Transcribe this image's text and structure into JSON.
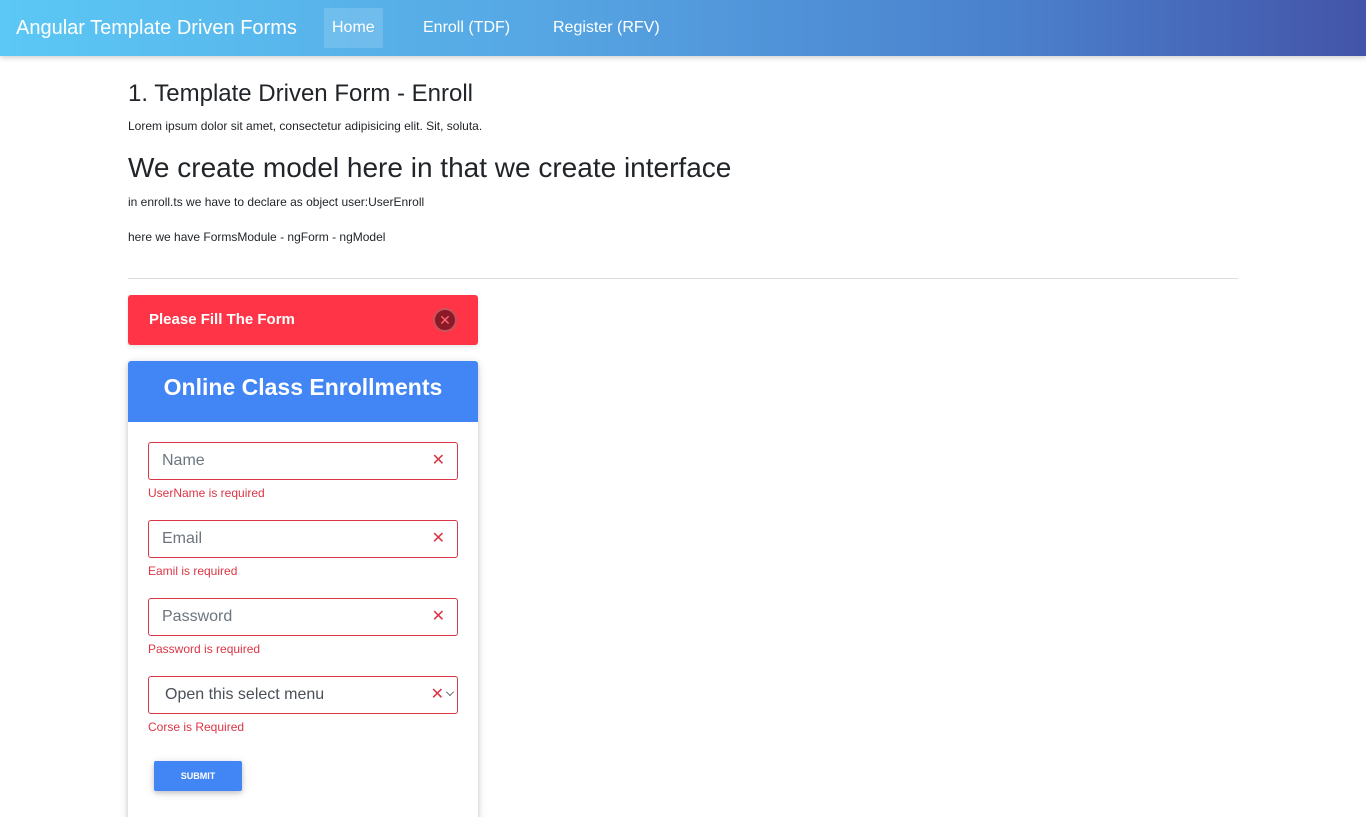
{
  "navbar": {
    "brand": "Angular Template Driven Forms",
    "links": [
      {
        "label": "Home",
        "active": true
      },
      {
        "label": "Enroll (TDF)",
        "active": false
      },
      {
        "label": "Register (RFV)",
        "active": false
      }
    ]
  },
  "main": {
    "title": "1. Template Driven Form - Enroll",
    "intro": "Lorem ipsum dolor sit amet, consectetur adipisicing elit. Sit, soluta.",
    "subtitle": "We create model here in that we create interface",
    "note1": "in enroll.ts we have to declare as object user:UserEnroll",
    "note2": "here we have FormsModule - ngForm - ngModel"
  },
  "alert": {
    "message": "Please Fill The Form",
    "close_icon": "close-circle-icon"
  },
  "form": {
    "header": "Online Class Enrollments",
    "name_placeholder": "Name",
    "name_error": "UserName is required",
    "email_placeholder": "Email",
    "email_error": "Eamil is required",
    "password_placeholder": "Password",
    "password_error": "Password is required",
    "course_selected": "Open this select menu",
    "course_error": "Corse is Required",
    "submit_label": "SUBMIT",
    "invalid_icon": "x-icon"
  },
  "colors": {
    "navbar_gradient_start": "#5bc8f5",
    "navbar_gradient_end": "#4454a8",
    "primary": "#4285f4",
    "danger": "#ff3547",
    "invalid": "#dc3545"
  }
}
